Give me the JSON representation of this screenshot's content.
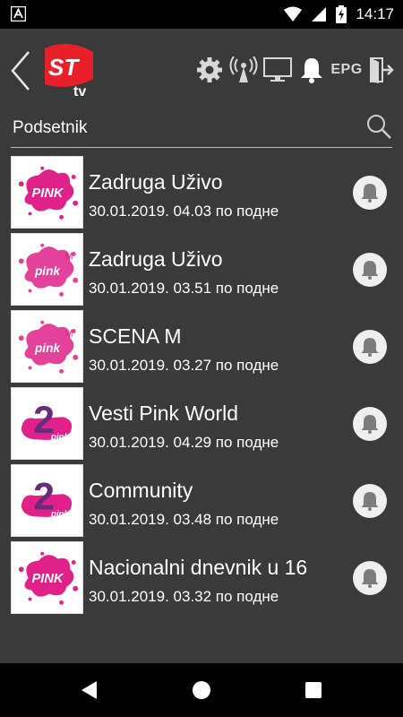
{
  "status_bar": {
    "time": "14:17",
    "icons": [
      "notification-a-icon",
      "wifi-icon",
      "signal-icon",
      "battery-charging-icon"
    ]
  },
  "header": {
    "logo_text": "ST tv",
    "icons": [
      "back-icon",
      "settings-icon",
      "broadcast-icon",
      "monitor-icon",
      "bell-icon",
      "exit-icon"
    ],
    "epg_label": "EPG",
    "accent_color": "#e8202a"
  },
  "search": {
    "title": "Podsetnik"
  },
  "reminders": [
    {
      "logo": "pink",
      "show": "Zadruga Uživo",
      "datetime": "30.01.2019. 04.03 по подне"
    },
    {
      "logo": "pink-m",
      "show": "Zadruga Uživo",
      "datetime": "30.01.2019. 03.51 по подне"
    },
    {
      "logo": "pink-m",
      "show": "SCENA M",
      "datetime": "30.01.2019. 03.27 по подне"
    },
    {
      "logo": "pink-2",
      "show": "Vesti Pink World",
      "datetime": "30.01.2019. 04.29 по подне"
    },
    {
      "logo": "pink-2",
      "show": "Community",
      "datetime": "30.01.2019. 03.48 по подне"
    },
    {
      "logo": "pink",
      "show": "Nacionalni dnevnik u 16",
      "datetime": "30.01.2019. 03.32 по подне"
    }
  ],
  "logo_texts": {
    "pink": "PINK",
    "pink_m": "pink",
    "pink_2_number": "2",
    "pink_2_word": "pink"
  },
  "nav_bar": {
    "icons": [
      "back-triangle-icon",
      "home-circle-icon",
      "recents-square-icon"
    ]
  }
}
